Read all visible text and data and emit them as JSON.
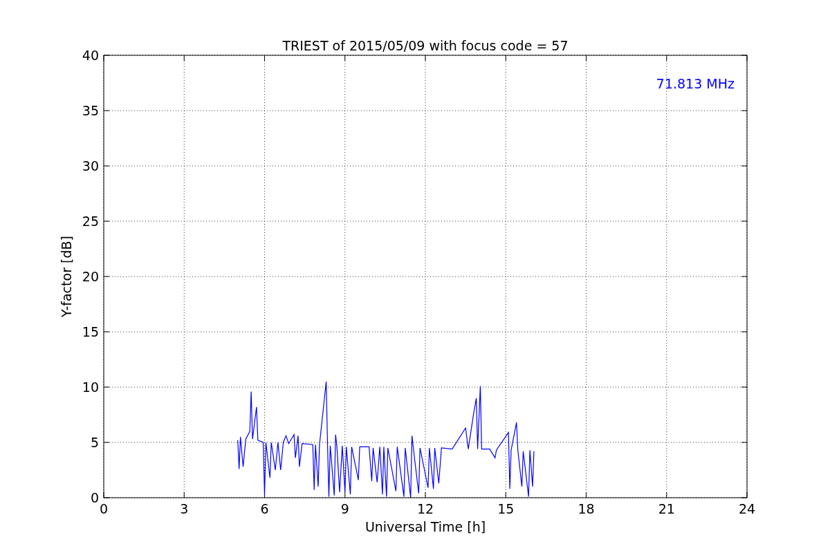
{
  "chart_data": {
    "type": "line",
    "title": "TRIEST of 2015/05/09 with focus code = 57",
    "xlabel": "Universal Time [h]",
    "ylabel": "Y-factor [dB]",
    "xlim": [
      0,
      24
    ],
    "ylim": [
      0,
      40
    ],
    "xticks": [
      0,
      3,
      6,
      9,
      12,
      15,
      18,
      21,
      24
    ],
    "yticks": [
      0,
      5,
      10,
      15,
      20,
      25,
      30,
      35,
      40
    ],
    "grid": true,
    "x": [
      5.0,
      5.05,
      5.1,
      5.2,
      5.3,
      5.45,
      5.5,
      5.55,
      5.7,
      5.75,
      5.95,
      6.0,
      6.05,
      6.2,
      6.25,
      6.4,
      6.5,
      6.6,
      6.7,
      6.8,
      6.9,
      7.1,
      7.15,
      7.25,
      7.3,
      7.4,
      7.8,
      7.85,
      7.9,
      8.0,
      8.05,
      8.3,
      8.35,
      8.4,
      8.45,
      8.6,
      8.65,
      8.7,
      8.8,
      8.9,
      9.0,
      9.05,
      9.2,
      9.25,
      9.5,
      9.55,
      9.9,
      10.0,
      10.05,
      10.2,
      10.3,
      10.4,
      10.45,
      10.55,
      10.6,
      10.9,
      10.95,
      11.2,
      11.25,
      11.45,
      11.5,
      11.55,
      11.75,
      11.8,
      12.1,
      12.15,
      12.3,
      12.35,
      12.5,
      12.6,
      13.0,
      13.5,
      13.6,
      13.8,
      13.9,
      13.95,
      14.05,
      14.1,
      14.4,
      14.6,
      14.65,
      15.1,
      15.15,
      15.2,
      15.4,
      15.45,
      15.6,
      15.65,
      15.85,
      15.9,
      16.0,
      16.05
    ],
    "series": [
      {
        "name": "71.813 MHz",
        "color": "#0000ff",
        "values": [
          5.2,
          2.6,
          5.5,
          2.8,
          5.3,
          6.0,
          9.6,
          5.3,
          8.2,
          5.2,
          5.0,
          0.2,
          5.0,
          1.8,
          5.0,
          2.5,
          5.0,
          2.5,
          5.0,
          5.6,
          4.9,
          5.7,
          3.6,
          5.6,
          2.8,
          4.9,
          4.8,
          0.7,
          4.8,
          1.0,
          4.8,
          10.5,
          4.7,
          0.1,
          4.7,
          0.2,
          5.7,
          4.6,
          0.5,
          4.7,
          0.5,
          4.6,
          0.3,
          4.6,
          1.6,
          4.6,
          4.6,
          1.5,
          4.5,
          1.4,
          4.6,
          0.3,
          4.6,
          0.1,
          4.5,
          0.6,
          4.6,
          0.1,
          4.5,
          0.0,
          5.6,
          4.5,
          0.4,
          4.5,
          0.9,
          4.5,
          0.8,
          4.5,
          1.3,
          4.5,
          4.4,
          6.3,
          4.4,
          7.6,
          9.0,
          4.4,
          10.1,
          4.4,
          4.4,
          3.6,
          4.3,
          5.9,
          0.8,
          4.3,
          6.8,
          4.3,
          1.0,
          4.2,
          0.1,
          4.3,
          1.0,
          4.2
        ]
      }
    ]
  }
}
